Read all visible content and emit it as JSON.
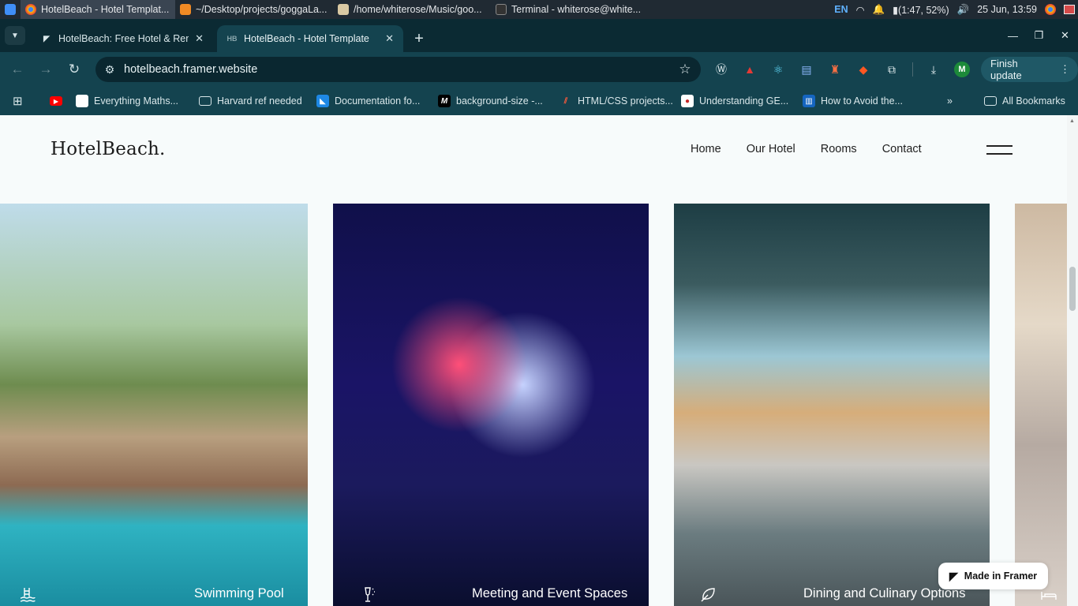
{
  "taskbar": {
    "tasks": [
      {
        "label": "HotelBeach - Hotel Templat...",
        "icon": "chrome-icon",
        "active": true
      },
      {
        "label": "~/Desktop/projects/goggaLa...",
        "icon": "sublime-icon",
        "active": false
      },
      {
        "label": "/home/whiterose/Music/goo...",
        "icon": "folder-icon",
        "active": false
      },
      {
        "label": "Terminal - whiterose@white...",
        "icon": "terminal-icon",
        "active": false
      }
    ],
    "lang": "EN",
    "battery": "(1:47, 52%)",
    "datetime": "25 Jun, 13:59"
  },
  "browser": {
    "tabs": [
      {
        "title": "HotelBeach: Free Hotel & Ren",
        "favicon": "framer-icon"
      },
      {
        "title": "HotelBeach - Hotel Template",
        "favicon": "HB"
      }
    ],
    "url": "hotelbeach.framer.website",
    "finish_update": "Finish update",
    "profile_initial": "M",
    "bookmarks": [
      {
        "label": "",
        "icon": "youtube-icon"
      },
      {
        "label": "Everything Maths...",
        "icon": "page-icon"
      },
      {
        "label": "Harvard ref needed",
        "icon": "folder-icon"
      },
      {
        "label": "Documentation fo...",
        "icon": "vscode-icon"
      },
      {
        "label": "background-size -...",
        "icon": "mdn-icon"
      },
      {
        "label": "HTML/CSS projects...",
        "icon": "projects-icon"
      },
      {
        "label": "Understanding GE...",
        "icon": "ge-icon"
      },
      {
        "label": "How to Avoid the...",
        "icon": "trello-icon"
      }
    ],
    "all_bookmarks": "All Bookmarks"
  },
  "site": {
    "brand": "HotelBeach.",
    "nav": [
      "Home",
      "Our Hotel",
      "Rooms",
      "Contact"
    ],
    "cards": [
      {
        "caption": "Swimming Pool",
        "icon": "pool-icon"
      },
      {
        "caption": "Meeting and Event Spaces",
        "icon": "champagne-icon"
      },
      {
        "caption": "Dining and Culinary Options",
        "icon": "leaf-icon"
      },
      {
        "caption": "",
        "icon": "bed-icon"
      }
    ],
    "framer_badge": "Made in Framer"
  }
}
